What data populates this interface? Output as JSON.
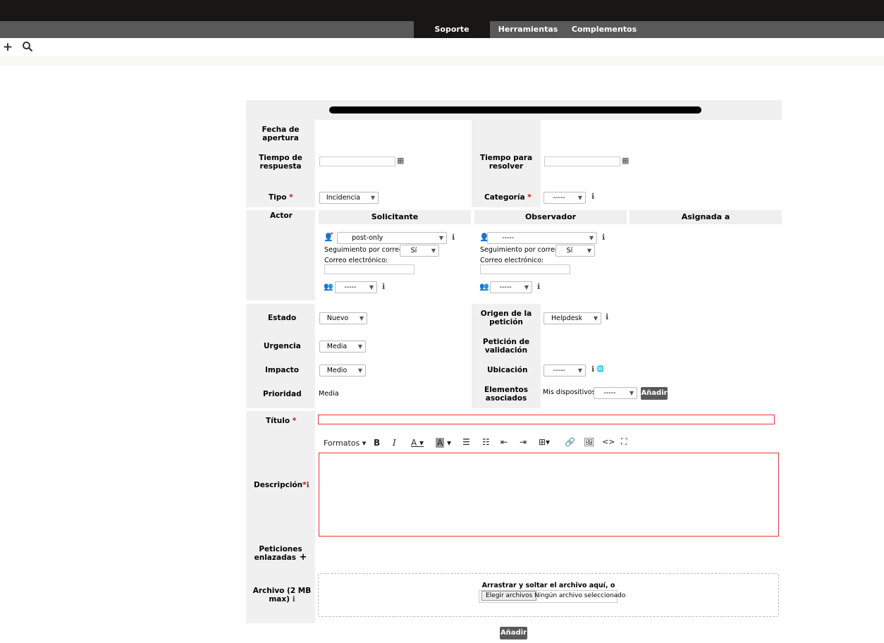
{
  "menu": {
    "items": [
      "Soporte",
      "Herramientas",
      "Complementos"
    ]
  },
  "toolbar": {
    "add_icon": "plus-icon",
    "search_icon": "search-icon"
  },
  "form": {
    "labels": {
      "fecha_apertura": "Fecha de apertura",
      "tiempo_respuesta": "Tiempo de respuesta",
      "tiempo_resolver": "Tiempo para resolver",
      "tipo": "Tipo",
      "categoria": "Categoría",
      "actor": "Actor",
      "estado": "Estado",
      "origen": "Origen de la petición",
      "urgencia": "Urgencia",
      "validacion": "Petición de validación",
      "impacto": "Impacto",
      "ubicacion": "Ubicación",
      "prioridad": "Prioridad",
      "elementos": "Elementos asociados",
      "titulo": "Título",
      "descripcion": "Descripción",
      "peticiones": "Peticiones enlazadas",
      "archivo": "Archivo (2 MB max)"
    },
    "values": {
      "tipo": "Incidencia",
      "categoria": "-----",
      "estado": "Nuevo",
      "origen": "Helpdesk",
      "urgencia": "Media",
      "impacto": "Medio",
      "ubicacion": "-----",
      "prioridad": "Media",
      "mis_dispositivos": "Mis dispositivos",
      "dispositivos_sel": "-----",
      "anadir": "Añadir"
    },
    "actor": {
      "headers": [
        "Solicitante",
        "Observador",
        "Asignada a"
      ],
      "solicitante": {
        "user": "post-only",
        "seguimiento_label": "Seguimiento por correo",
        "seguimiento": "Sí",
        "correo_label": "Correo electrónico:",
        "grupo": "-----"
      },
      "observador": {
        "user": "-----",
        "seguimiento_label": "Seguimiento por correo",
        "seguimiento": "Sí",
        "correo_label": "Correo electrónico:",
        "grupo": "-----"
      }
    },
    "editor": {
      "formatos": "Formatos"
    },
    "file": {
      "drop_text": "Arrastrar y soltar el archivo aquí, o",
      "choose": "Elegir archivos",
      "none": "Ningún archivo seleccionado"
    },
    "submit": "Añadir"
  }
}
